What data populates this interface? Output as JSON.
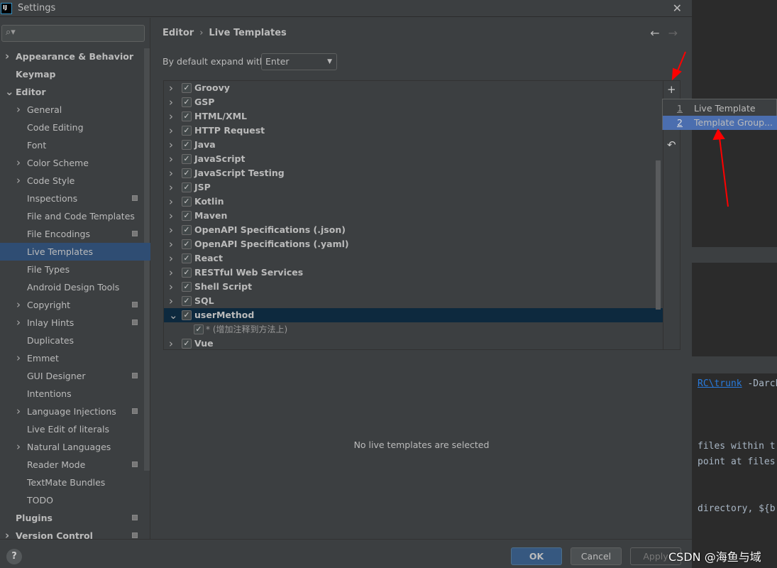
{
  "window": {
    "title": "Settings",
    "logo": "IJ"
  },
  "sidebar": {
    "search_placeholder": "",
    "items": [
      {
        "label": "Appearance & Behavior",
        "level": 0,
        "chevron": "right",
        "bold": true
      },
      {
        "label": "Keymap",
        "level": 0,
        "chevron": "",
        "bold": true
      },
      {
        "label": "Editor",
        "level": 0,
        "chevron": "down",
        "bold": true
      },
      {
        "label": "General",
        "level": 1,
        "chevron": "right"
      },
      {
        "label": "Code Editing",
        "level": 1,
        "chevron": ""
      },
      {
        "label": "Font",
        "level": 1,
        "chevron": ""
      },
      {
        "label": "Color Scheme",
        "level": 1,
        "chevron": "right"
      },
      {
        "label": "Code Style",
        "level": 1,
        "chevron": "right"
      },
      {
        "label": "Inspections",
        "level": 1,
        "chevron": "",
        "mark": true
      },
      {
        "label": "File and Code Templates",
        "level": 1,
        "chevron": ""
      },
      {
        "label": "File Encodings",
        "level": 1,
        "chevron": "",
        "mark": true
      },
      {
        "label": "Live Templates",
        "level": 1,
        "chevron": "",
        "selected": true
      },
      {
        "label": "File Types",
        "level": 1,
        "chevron": ""
      },
      {
        "label": "Android Design Tools",
        "level": 1,
        "chevron": ""
      },
      {
        "label": "Copyright",
        "level": 1,
        "chevron": "right",
        "mark": true
      },
      {
        "label": "Inlay Hints",
        "level": 1,
        "chevron": "right",
        "mark": true
      },
      {
        "label": "Duplicates",
        "level": 1,
        "chevron": ""
      },
      {
        "label": "Emmet",
        "level": 1,
        "chevron": "right"
      },
      {
        "label": "GUI Designer",
        "level": 1,
        "chevron": "",
        "mark": true
      },
      {
        "label": "Intentions",
        "level": 1,
        "chevron": ""
      },
      {
        "label": "Language Injections",
        "level": 1,
        "chevron": "right",
        "mark": true
      },
      {
        "label": "Live Edit of literals",
        "level": 1,
        "chevron": ""
      },
      {
        "label": "Natural Languages",
        "level": 1,
        "chevron": "right"
      },
      {
        "label": "Reader Mode",
        "level": 1,
        "chevron": "",
        "mark": true
      },
      {
        "label": "TextMate Bundles",
        "level": 1,
        "chevron": ""
      },
      {
        "label": "TODO",
        "level": 1,
        "chevron": ""
      },
      {
        "label": "Plugins",
        "level": 0,
        "chevron": "",
        "bold": true,
        "mark": true
      },
      {
        "label": "Version Control",
        "level": 0,
        "chevron": "right",
        "bold": true,
        "mark": true
      }
    ]
  },
  "header": {
    "breadcrumb": [
      "Editor",
      "Live Templates"
    ],
    "separator": "›",
    "back": "←",
    "forward": "→"
  },
  "expand": {
    "label": "By default expand with",
    "value": "Enter"
  },
  "templates": [
    {
      "label": "Groovy",
      "checked": true
    },
    {
      "label": "GSP",
      "checked": true
    },
    {
      "label": "HTML/XML",
      "checked": true
    },
    {
      "label": "HTTP Request",
      "checked": true
    },
    {
      "label": "Java",
      "checked": true
    },
    {
      "label": "JavaScript",
      "checked": true
    },
    {
      "label": "JavaScript Testing",
      "checked": true
    },
    {
      "label": "JSP",
      "checked": true
    },
    {
      "label": "Kotlin",
      "checked": true
    },
    {
      "label": "Maven",
      "checked": true
    },
    {
      "label": "OpenAPI Specifications (.json)",
      "checked": true
    },
    {
      "label": "OpenAPI Specifications (.yaml)",
      "checked": true
    },
    {
      "label": "React",
      "checked": true
    },
    {
      "label": "RESTful Web Services",
      "checked": true
    },
    {
      "label": "Shell Script",
      "checked": true
    },
    {
      "label": "SQL",
      "checked": true
    },
    {
      "label": "userMethod",
      "checked": true,
      "expanded": true,
      "selected": true
    },
    {
      "label": "* (增加注释到方法上)",
      "checked": true,
      "child": true
    },
    {
      "label": "Vue",
      "checked": true
    }
  ],
  "toolbar": {
    "add": "+",
    "revert": "↶"
  },
  "popup": {
    "items": [
      {
        "num": "1",
        "label": "Live Template"
      },
      {
        "num": "2",
        "label": "Template Group...",
        "selected": true
      }
    ]
  },
  "empty_text": "No live templates are selected",
  "footer": {
    "help": "?",
    "ok": "OK",
    "cancel": "Cancel",
    "apply": "Apply"
  },
  "editor_bg": {
    "lines": [
      {
        "link": "RC\\trunk",
        "rest": " -Darch"
      },
      {
        "text": "files within t"
      },
      {
        "text": "point at files"
      },
      {
        "text": "directory, ${b"
      }
    ]
  },
  "watermark": "CSDN @海鱼与域",
  "colors": {
    "selection": "#2f4d73",
    "popup_selection": "#4b6eaf",
    "ok_button": "#365880",
    "annotation_arrow": "#ff0000"
  }
}
